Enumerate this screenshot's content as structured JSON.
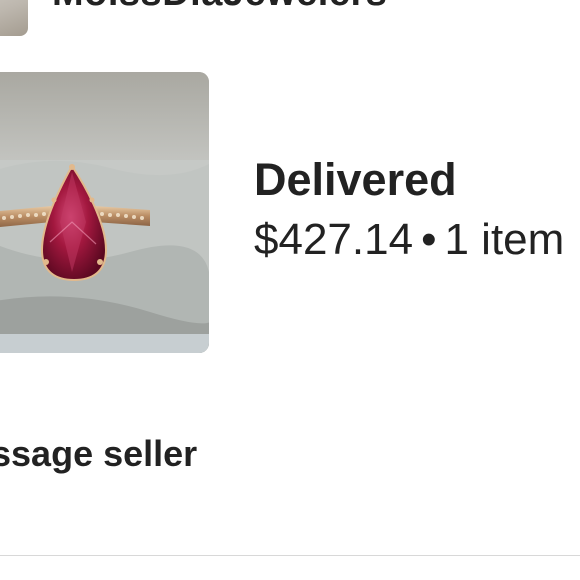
{
  "shop": {
    "name": "MoissDiaJewelers"
  },
  "order": {
    "status": "Delivered",
    "price": "$427.14",
    "separator": "•",
    "item_count": "1 item",
    "product_image": "pear-shaped-pink-gemstone-ring"
  },
  "actions": {
    "message_seller": "Message seller"
  },
  "colors": {
    "text": "#222222",
    "divider": "#d8d8d8",
    "background": "#ffffff"
  }
}
